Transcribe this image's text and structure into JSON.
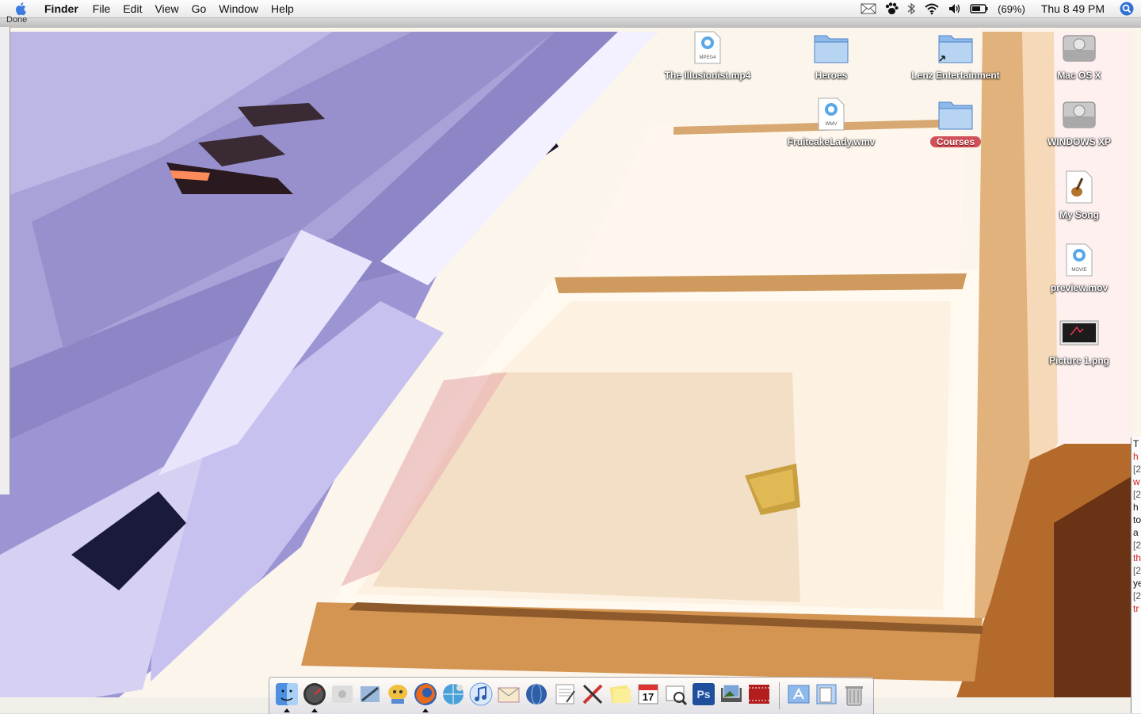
{
  "menubar": {
    "app_name": "Finder",
    "menus": [
      "File",
      "Edit",
      "View",
      "Go",
      "Window",
      "Help"
    ],
    "battery_text": "(69%)",
    "clock": "Thu 8 49 PM",
    "status_icons": [
      "mail-icon",
      "paw-icon",
      "bluetooth-icon",
      "wifi-icon",
      "volume-icon",
      "battery-icon",
      "spotlight-icon"
    ]
  },
  "window_remnant": {
    "status_text": "Done",
    "right_window_lines": [
      "T",
      "h",
      "[2",
      "w",
      "[2",
      "h",
      "to",
      "a",
      "[2",
      "th",
      "[2",
      "ye",
      "[2",
      "tr"
    ]
  },
  "desktop": {
    "icons": [
      {
        "name": "The Illusionist.mp4",
        "kind": "quicktime-mpeg4-file-icon",
        "badge": "MPEG4"
      },
      {
        "name": "Heroes",
        "kind": "folder-icon"
      },
      {
        "name": "Lenz Entertainment",
        "kind": "folder-alias-icon"
      },
      {
        "name": "Mac OS X",
        "kind": "hard-drive-icon"
      },
      {
        "name": "FruitcakeLady.wmv",
        "kind": "quicktime-wmv-file-icon",
        "badge": "WMV"
      },
      {
        "name": "Courses",
        "kind": "folder-icon",
        "selected": true
      },
      {
        "name": "WINDOWS XP",
        "kind": "hard-drive-icon"
      },
      {
        "name": "My Song",
        "kind": "garageband-file-icon"
      },
      {
        "name": "preview.mov",
        "kind": "quicktime-movie-file-icon",
        "badge": "MOVIE"
      },
      {
        "name": "Picture 1.png",
        "kind": "png-image-icon"
      }
    ]
  },
  "dock": {
    "items": [
      {
        "name": "finder-icon",
        "running": true
      },
      {
        "name": "dashboard-icon",
        "running": true
      },
      {
        "name": "apple-icon",
        "running": false
      },
      {
        "name": "mail-icon",
        "running": false
      },
      {
        "name": "ichat-icon",
        "running": false
      },
      {
        "name": "firefox-icon",
        "running": true
      },
      {
        "name": "network-globe-icon",
        "running": false
      },
      {
        "name": "itunes-icon",
        "running": false
      },
      {
        "name": "mail-stamp-icon",
        "running": false
      },
      {
        "name": "globe-icon",
        "running": false
      },
      {
        "name": "textedit-icon",
        "running": false
      },
      {
        "name": "tools-icon",
        "running": false
      },
      {
        "name": "stickies-icon",
        "running": false
      },
      {
        "name": "ical-icon",
        "running": false,
        "label": "17"
      },
      {
        "name": "preview-icon",
        "running": false
      },
      {
        "name": "photoshop-icon",
        "running": false,
        "label": "Ps"
      },
      {
        "name": "iphoto-icon",
        "running": false
      },
      {
        "name": "imovie-icon",
        "running": false
      },
      {
        "name": "applications-folder-icon",
        "running": false
      },
      {
        "name": "documents-stack-icon",
        "running": false
      },
      {
        "name": "trash-icon",
        "running": false
      }
    ]
  },
  "colors": {
    "selection_label": "#d0515a",
    "menubar_bg": "#f2f2f2",
    "wallpaper_purple": "#8d84c9",
    "wallpaper_cream": "#fbf3ea",
    "wallpaper_amber": "#c9853e"
  }
}
